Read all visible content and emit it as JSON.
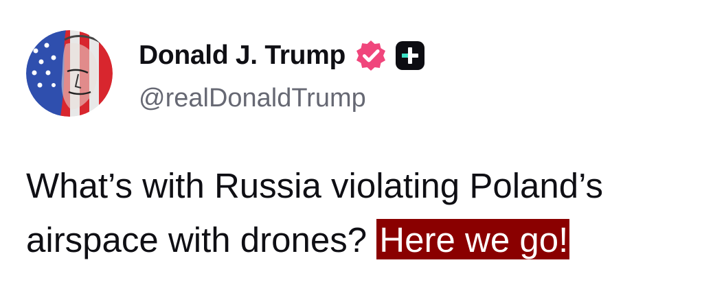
{
  "post": {
    "author": {
      "display_name": "Donald J. Trump",
      "handle": "@realDonaldTrump",
      "avatar_icon": "flag-portrait-avatar",
      "verified_icon": "verified-badge-icon",
      "verified_color": "#f0467c",
      "plus_icon": "plus-badge-icon"
    },
    "body": {
      "line1": "What’s with Russia violating Poland’s",
      "line2_text": "airspace with drones? ",
      "line2_highlight": "Here we go!"
    },
    "colors": {
      "text": "#0f0f14",
      "handle": "#666873",
      "highlight_bg": "#8a0000",
      "highlight_text": "#ffffff",
      "plus_badge_bg": "#0d0d12",
      "plus_badge_accent": "#3ce0c4"
    }
  }
}
